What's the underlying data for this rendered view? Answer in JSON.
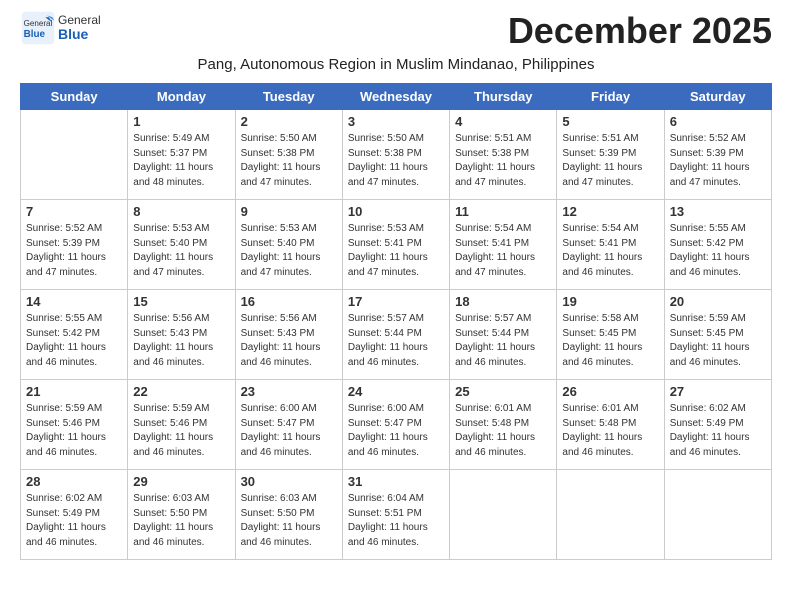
{
  "header": {
    "logo_general": "General",
    "logo_blue": "Blue",
    "month_title": "December 2025",
    "subtitle": "Pang, Autonomous Region in Muslim Mindanao, Philippines"
  },
  "weekdays": [
    "Sunday",
    "Monday",
    "Tuesday",
    "Wednesday",
    "Thursday",
    "Friday",
    "Saturday"
  ],
  "weeks": [
    [
      {
        "day": "",
        "info": ""
      },
      {
        "day": "1",
        "info": "Sunrise: 5:49 AM\nSunset: 5:37 PM\nDaylight: 11 hours\nand 48 minutes."
      },
      {
        "day": "2",
        "info": "Sunrise: 5:50 AM\nSunset: 5:38 PM\nDaylight: 11 hours\nand 47 minutes."
      },
      {
        "day": "3",
        "info": "Sunrise: 5:50 AM\nSunset: 5:38 PM\nDaylight: 11 hours\nand 47 minutes."
      },
      {
        "day": "4",
        "info": "Sunrise: 5:51 AM\nSunset: 5:38 PM\nDaylight: 11 hours\nand 47 minutes."
      },
      {
        "day": "5",
        "info": "Sunrise: 5:51 AM\nSunset: 5:39 PM\nDaylight: 11 hours\nand 47 minutes."
      },
      {
        "day": "6",
        "info": "Sunrise: 5:52 AM\nSunset: 5:39 PM\nDaylight: 11 hours\nand 47 minutes."
      }
    ],
    [
      {
        "day": "7",
        "info": "Sunrise: 5:52 AM\nSunset: 5:39 PM\nDaylight: 11 hours\nand 47 minutes."
      },
      {
        "day": "8",
        "info": "Sunrise: 5:53 AM\nSunset: 5:40 PM\nDaylight: 11 hours\nand 47 minutes."
      },
      {
        "day": "9",
        "info": "Sunrise: 5:53 AM\nSunset: 5:40 PM\nDaylight: 11 hours\nand 47 minutes."
      },
      {
        "day": "10",
        "info": "Sunrise: 5:53 AM\nSunset: 5:41 PM\nDaylight: 11 hours\nand 47 minutes."
      },
      {
        "day": "11",
        "info": "Sunrise: 5:54 AM\nSunset: 5:41 PM\nDaylight: 11 hours\nand 47 minutes."
      },
      {
        "day": "12",
        "info": "Sunrise: 5:54 AM\nSunset: 5:41 PM\nDaylight: 11 hours\nand 46 minutes."
      },
      {
        "day": "13",
        "info": "Sunrise: 5:55 AM\nSunset: 5:42 PM\nDaylight: 11 hours\nand 46 minutes."
      }
    ],
    [
      {
        "day": "14",
        "info": "Sunrise: 5:55 AM\nSunset: 5:42 PM\nDaylight: 11 hours\nand 46 minutes."
      },
      {
        "day": "15",
        "info": "Sunrise: 5:56 AM\nSunset: 5:43 PM\nDaylight: 11 hours\nand 46 minutes."
      },
      {
        "day": "16",
        "info": "Sunrise: 5:56 AM\nSunset: 5:43 PM\nDaylight: 11 hours\nand 46 minutes."
      },
      {
        "day": "17",
        "info": "Sunrise: 5:57 AM\nSunset: 5:44 PM\nDaylight: 11 hours\nand 46 minutes."
      },
      {
        "day": "18",
        "info": "Sunrise: 5:57 AM\nSunset: 5:44 PM\nDaylight: 11 hours\nand 46 minutes."
      },
      {
        "day": "19",
        "info": "Sunrise: 5:58 AM\nSunset: 5:45 PM\nDaylight: 11 hours\nand 46 minutes."
      },
      {
        "day": "20",
        "info": "Sunrise: 5:59 AM\nSunset: 5:45 PM\nDaylight: 11 hours\nand 46 minutes."
      }
    ],
    [
      {
        "day": "21",
        "info": "Sunrise: 5:59 AM\nSunset: 5:46 PM\nDaylight: 11 hours\nand 46 minutes."
      },
      {
        "day": "22",
        "info": "Sunrise: 5:59 AM\nSunset: 5:46 PM\nDaylight: 11 hours\nand 46 minutes."
      },
      {
        "day": "23",
        "info": "Sunrise: 6:00 AM\nSunset: 5:47 PM\nDaylight: 11 hours\nand 46 minutes."
      },
      {
        "day": "24",
        "info": "Sunrise: 6:00 AM\nSunset: 5:47 PM\nDaylight: 11 hours\nand 46 minutes."
      },
      {
        "day": "25",
        "info": "Sunrise: 6:01 AM\nSunset: 5:48 PM\nDaylight: 11 hours\nand 46 minutes."
      },
      {
        "day": "26",
        "info": "Sunrise: 6:01 AM\nSunset: 5:48 PM\nDaylight: 11 hours\nand 46 minutes."
      },
      {
        "day": "27",
        "info": "Sunrise: 6:02 AM\nSunset: 5:49 PM\nDaylight: 11 hours\nand 46 minutes."
      }
    ],
    [
      {
        "day": "28",
        "info": "Sunrise: 6:02 AM\nSunset: 5:49 PM\nDaylight: 11 hours\nand 46 minutes."
      },
      {
        "day": "29",
        "info": "Sunrise: 6:03 AM\nSunset: 5:50 PM\nDaylight: 11 hours\nand 46 minutes."
      },
      {
        "day": "30",
        "info": "Sunrise: 6:03 AM\nSunset: 5:50 PM\nDaylight: 11 hours\nand 46 minutes."
      },
      {
        "day": "31",
        "info": "Sunrise: 6:04 AM\nSunset: 5:51 PM\nDaylight: 11 hours\nand 46 minutes."
      },
      {
        "day": "",
        "info": ""
      },
      {
        "day": "",
        "info": ""
      },
      {
        "day": "",
        "info": ""
      }
    ]
  ]
}
